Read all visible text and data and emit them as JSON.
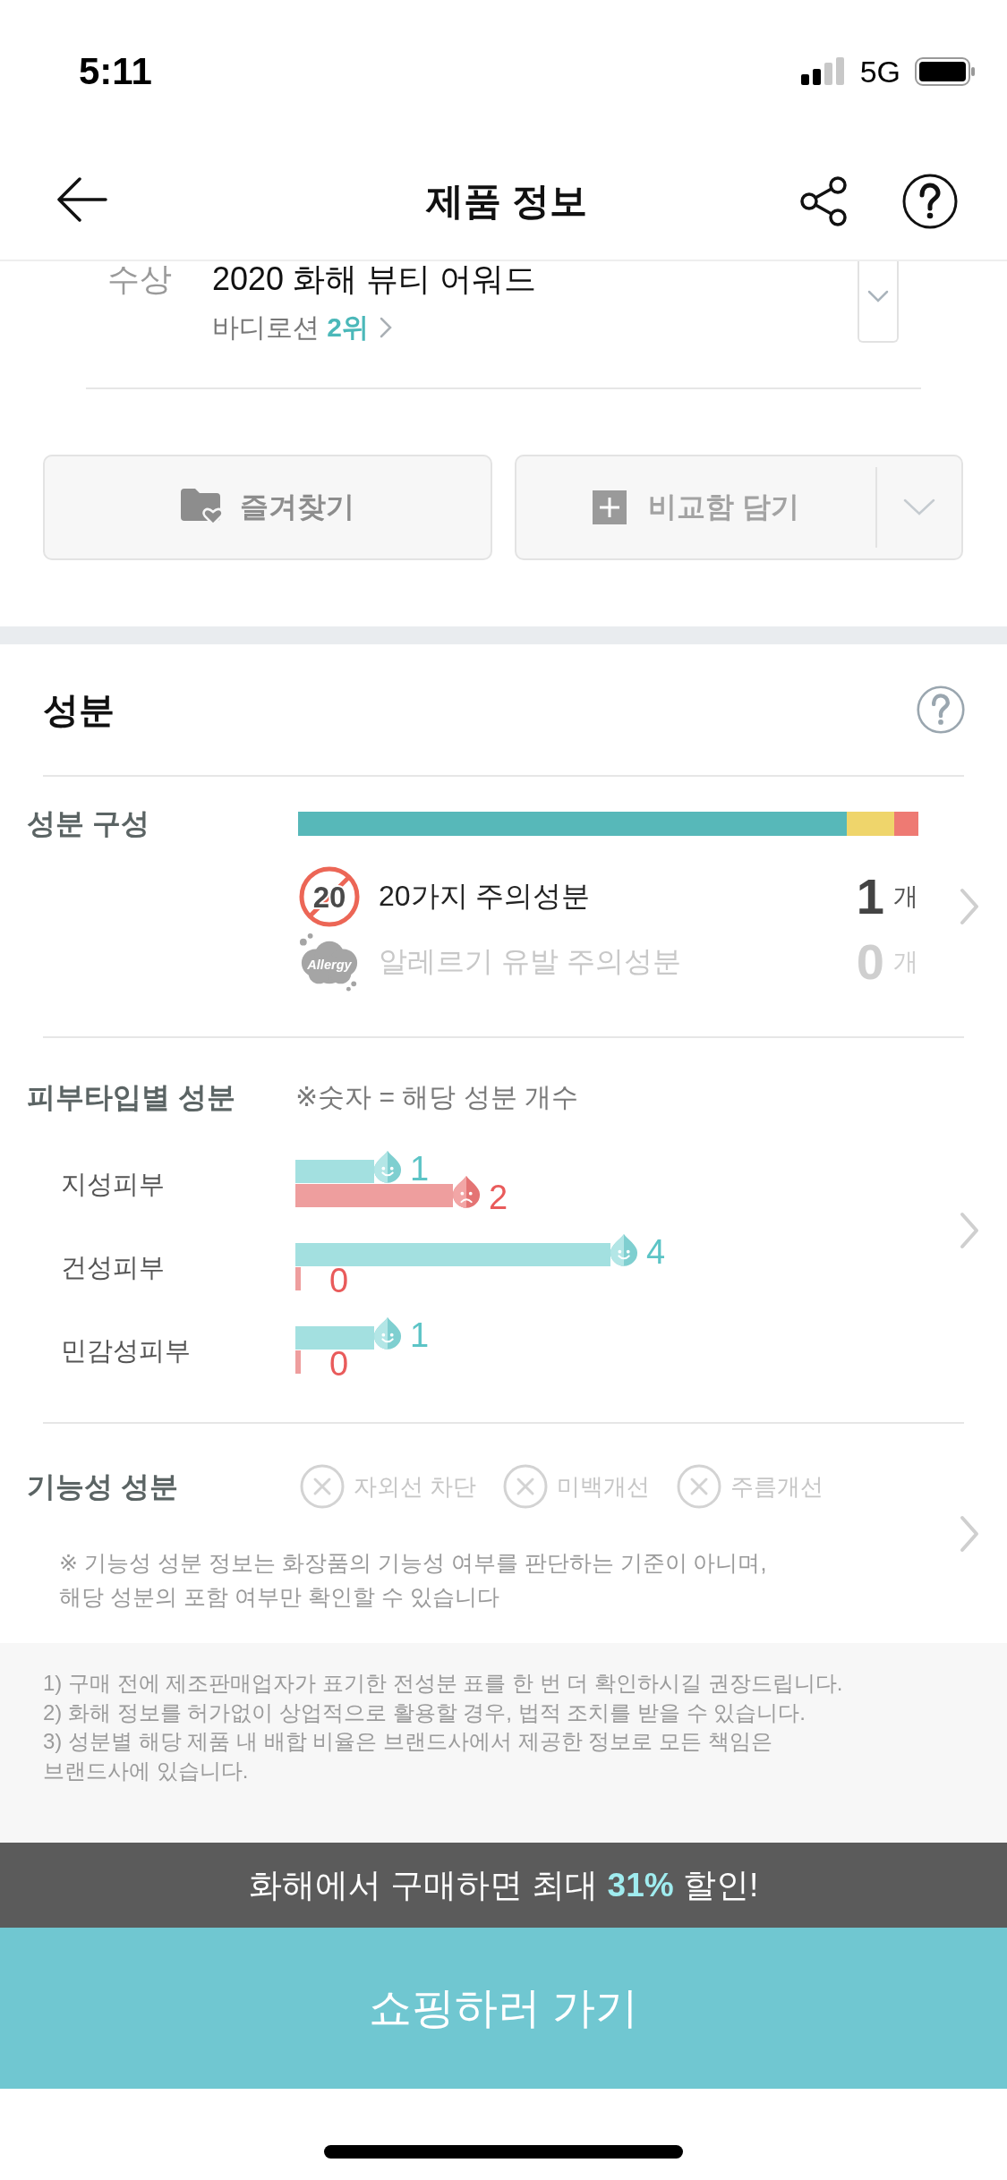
{
  "status_bar": {
    "time": "5:11",
    "network": "5G"
  },
  "header": {
    "title": "제품 정보"
  },
  "award": {
    "label": "수상",
    "title": "2020 화해 뷰티 어워드",
    "ranking": "바디로션 **2위**"
  },
  "actions": {
    "favorite": {
      "label": "즐겨찾기"
    },
    "compare": {
      "label": "비교함 담기"
    }
  },
  "ingredients": {
    "title": "성분",
    "composition": {
      "label": "성분 구성",
      "rows": [
        {
          "kind": "twenty",
          "badge": "20",
          "label": "20가지 주의성분",
          "count": "1",
          "unit": "개",
          "active": true
        },
        {
          "kind": "allergy",
          "badge": "Allergy",
          "label": "알레르기 유발 주의성분",
          "count": "0",
          "unit": "개",
          "active": false
        }
      ]
    },
    "skin_types": {
      "label": "피부타입별 성분",
      "legend": "※숫자 = 해당 성분 개수",
      "chart_data": {
        "type": "bar",
        "orientation": "horizontal",
        "categories": [
          "지성피부",
          "건성피부",
          "민감성피부"
        ],
        "series": [
          {
            "color": "#a3e0e0",
            "values": [
              1,
              4,
              1
            ]
          },
          {
            "color": "#ee9e9e",
            "values": [
              2,
              0,
              0
            ]
          }
        ],
        "data_labels": true
      }
    },
    "functional": {
      "label": "기능성 성분",
      "items": [
        {
          "label": "자외선 차단",
          "contained": false
        },
        {
          "label": "미백개선",
          "contained": false
        },
        {
          "label": "주름개선",
          "contained": false
        }
      ],
      "note": "※ 기능성 성분 정보는 화장품의 기능성 여부를 판단하는 기준이 아니며,\n해당 성분의 포함 여부만 확인할 수 있습니다"
    }
  },
  "disclaimers": [
    "1) 구매 전에 제조판매업자가 표기한 전성분 표를 한 번 더 확인하시길 권장드립니다.",
    "2) 화해 정보를 허가없이 상업적으로 활용할 경우, 법적 조치를 받을 수 있습니다.",
    "3) 성분별 해당 제품 내 배합 비율은 브랜드사에서 제공한 정보로 모든 책임은\n브랜드사에 있습니다."
  ],
  "promo_banner": {
    "text": "화해에서 구매하면 최대 **31%** 할인!"
  },
  "shop_button": {
    "label": "쇼핑하러 가기"
  }
}
